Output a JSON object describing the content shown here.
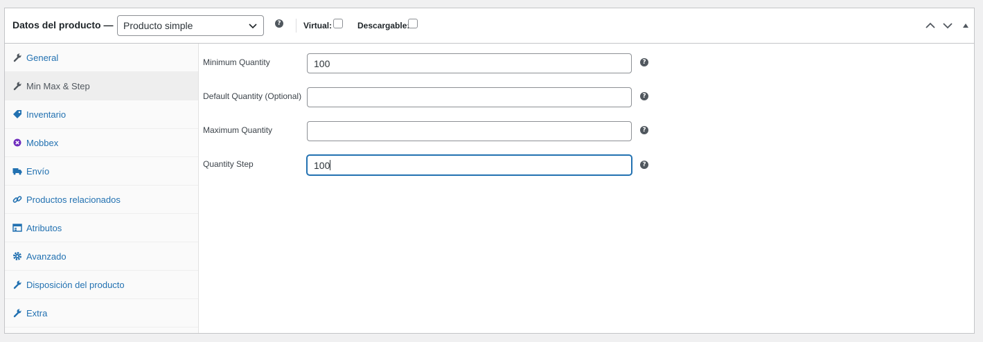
{
  "header": {
    "title": "Datos del producto —",
    "product_type": "Producto simple",
    "virtual_label": "Virtual:",
    "downloadable_label": "Descargable:"
  },
  "sidebar": {
    "items": [
      {
        "label": "General",
        "icon": "wrench-icon"
      },
      {
        "label": "Min Max & Step",
        "icon": "wrench-icon",
        "active": true
      },
      {
        "label": "Inventario",
        "icon": "tag-icon"
      },
      {
        "label": "Mobbex",
        "icon": "mobbex-icon"
      },
      {
        "label": "Envío",
        "icon": "truck-icon"
      },
      {
        "label": "Productos relacionados",
        "icon": "link-icon"
      },
      {
        "label": "Atributos",
        "icon": "list-icon"
      },
      {
        "label": "Avanzado",
        "icon": "gear-icon"
      },
      {
        "label": "Disposición del producto",
        "icon": "wrench-icon"
      },
      {
        "label": "Extra",
        "icon": "wrench-icon"
      }
    ]
  },
  "fields": {
    "min": {
      "label": "Minimum Quantity",
      "value": "100"
    },
    "default": {
      "label": "Default Quantity (Optional)",
      "value": ""
    },
    "max": {
      "label": "Maximum Quantity",
      "value": ""
    },
    "step": {
      "label": "Quantity Step",
      "value": "100"
    }
  },
  "help_glyph": "?",
  "colors": {
    "link": "#2271b1",
    "focus": "#2271b1",
    "mobbex": "#6f2dbd"
  }
}
